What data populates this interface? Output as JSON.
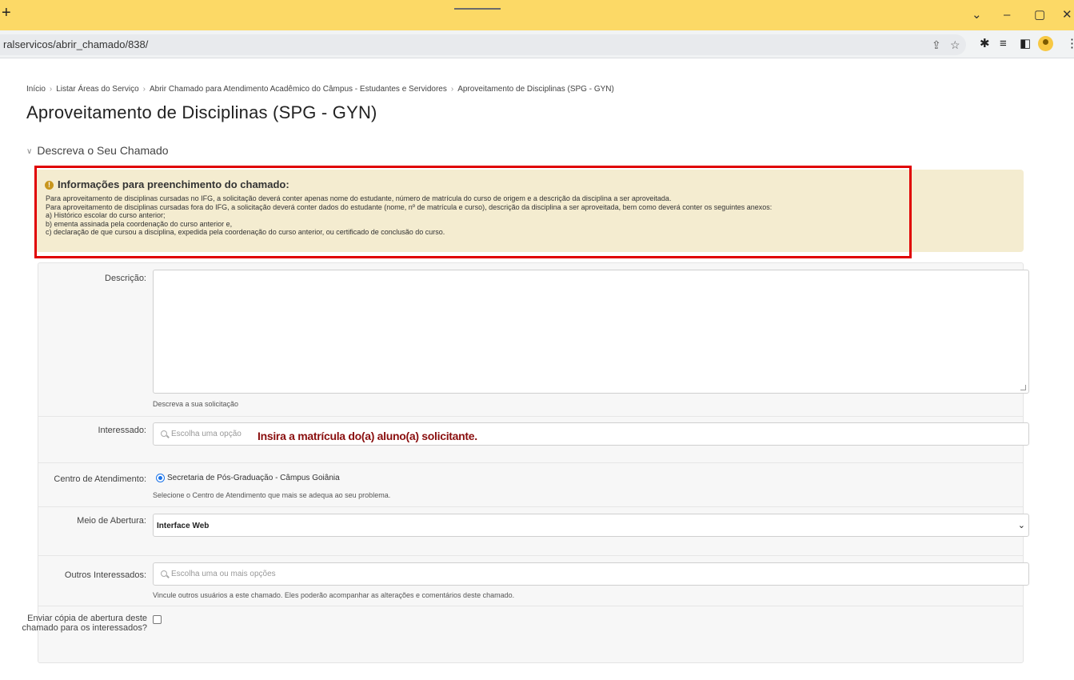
{
  "browser": {
    "newtab_glyph": "+",
    "url": "ralservicos/abrir_chamado/838/",
    "window_controls": [
      "⌄",
      "–",
      "▢",
      "✕"
    ]
  },
  "breadcrumb": [
    "Início",
    "Listar Áreas do Serviço",
    "Abrir Chamado para Atendimento Acadêmico do Câmpus - Estudantes e Servidores",
    "Aproveitamento de Disciplinas (SPG - GYN)"
  ],
  "page_title": "Aproveitamento de Disciplinas (SPG - GYN)",
  "section": {
    "title": "Descreva o Seu Chamado"
  },
  "info": {
    "title": "Informações para preenchimento do chamado:",
    "lines": [
      "Para aproveitamento de disciplinas cursadas no IFG, a solicitação deverá conter apenas nome do estudante, número de matrícula do curso de origem e a descrição da disciplina a ser aproveitada.",
      "Para aproveitamento de disciplinas cursadas fora do IFG, a solicitação deverá conter dados do estudante (nome, nº de matrícula e curso), descrição da disciplina a ser aproveitada, bem como deverá conter os seguintes anexos:",
      "a) Histórico escolar do curso anterior;",
      "b) ementa assinada pela coordenação do curso anterior e,",
      "c) declaração de que cursou a disciplina, expedida pela coordenação do curso anterior, ou certificado de conclusão do curso."
    ],
    "highlight_color": "#e00000"
  },
  "form": {
    "descricao": {
      "label": "Descrição:",
      "help": "Descreva a sua solicitação"
    },
    "interessado": {
      "label": "Interessado:",
      "placeholder": "Escolha uma opção",
      "annotation": "Insira a matrícula do(a) aluno(a) solicitante."
    },
    "centro": {
      "label": "Centro de Atendimento:",
      "option": "Secretaria de Pós-Graduação - Câmpus Goiânia",
      "help": "Selecione o Centro de Atendimento que mais se adequa ao seu problema."
    },
    "meio": {
      "label": "Meio de Abertura:",
      "value": "Interface Web"
    },
    "outros": {
      "label": "Outros Interessados:",
      "placeholder": "Escolha uma ou mais opções",
      "help": "Vincule outros usuários a este chamado. Eles poderão acompanhar as alterações e comentários deste chamado."
    },
    "copia": {
      "label": "Enviar cópia de abertura deste chamado para os interessados?"
    }
  }
}
